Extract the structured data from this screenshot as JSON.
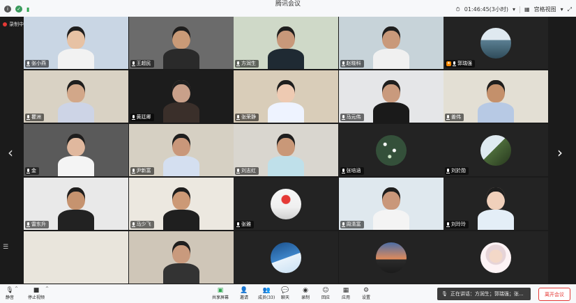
{
  "window": {
    "title": "腾讯会议"
  },
  "topbar": {
    "time": "01:46:45(3小时)",
    "view_label": "宫格视图"
  },
  "recording": {
    "label": "录制中"
  },
  "participants": [
    {
      "name": "张小燕",
      "bg": "#c9d6e4",
      "shirt": "#f2f2f2",
      "skin": "#e7c2a4",
      "avatar": ""
    },
    {
      "name": "王超民",
      "bg": "#6b6b6b",
      "shirt": "#2a2a2a",
      "skin": "#c99a77",
      "avatar": ""
    },
    {
      "name": "方润生",
      "bg": "#cfd9c8",
      "shirt": "#1f2a33",
      "skin": "#c8987a",
      "avatar": ""
    },
    {
      "name": "赵晓科",
      "bg": "#c7d3d9",
      "shirt": "#f0f0f0",
      "skin": "#c9997a",
      "avatar": ""
    },
    {
      "name": "郭瑞强",
      "bg": "#232323",
      "shirt": "",
      "skin": "",
      "avatar": "lake",
      "host": true
    },
    {
      "name": "瞿洲",
      "bg": "#d9d2c4",
      "shirt": "#cdd4e6",
      "skin": "#d2a789",
      "avatar": ""
    },
    {
      "name": "黄廷卿",
      "bg": "#1c1c1c",
      "shirt": "#3a2f2a",
      "skin": "#c9a08a",
      "avatar": ""
    },
    {
      "name": "张荣静",
      "bg": "#d9cdb9",
      "shirt": "#eef3ff",
      "skin": "#eecab2",
      "avatar": ""
    },
    {
      "name": "马元伟",
      "bg": "#e5e6e8",
      "shirt": "#1a1a1a",
      "skin": "#c99a7d",
      "avatar": ""
    },
    {
      "name": "姜伟",
      "bg": "#e3dfd4",
      "shirt": "#b7c9e4",
      "skin": "#c4906b",
      "avatar": ""
    },
    {
      "name": "金",
      "bg": "#5a5a5a",
      "shirt": "#f4f4f4",
      "skin": "#e0b89e",
      "avatar": ""
    },
    {
      "name": "尹新富",
      "bg": "#d6d0c3",
      "shirt": "#d4dff0",
      "skin": "#c9977a",
      "avatar": ""
    },
    {
      "name": "刘志红",
      "bg": "#d9d6cf",
      "shirt": "#bfe0ea",
      "skin": "#c99878",
      "avatar": ""
    },
    {
      "name": "张培涵",
      "bg": "#232323",
      "shirt": "",
      "skin": "",
      "avatar": "flowers"
    },
    {
      "name": "刘於勋",
      "bg": "#232323",
      "shirt": "",
      "skin": "",
      "avatar": "bird"
    },
    {
      "name": "雷东升",
      "bg": "#e9e9e9",
      "shirt": "#222",
      "skin": "#c6936f",
      "avatar": ""
    },
    {
      "name": "马少飞",
      "bg": "#ece8e0",
      "shirt": "#1f1f1f",
      "skin": "#cc9976",
      "avatar": ""
    },
    {
      "name": "张雅",
      "bg": "#232323",
      "shirt": "",
      "skin": "",
      "avatar": "balloon"
    },
    {
      "name": "周清富",
      "bg": "#dfe8ee",
      "shirt": "#f4f4f4",
      "skin": "#c9977a",
      "avatar": ""
    },
    {
      "name": "刘玲玲",
      "bg": "#232323",
      "shirt": "#e4eef7",
      "skin": "#f0d0bb",
      "avatar": ""
    },
    {
      "name": "",
      "bg": "#e9e5dc",
      "shirt": "",
      "skin": "",
      "avatar": ""
    },
    {
      "name": "",
      "bg": "#cfc6b8",
      "shirt": "#333",
      "skin": "#c99a7d",
      "avatar": ""
    },
    {
      "name": "",
      "bg": "#232323",
      "shirt": "",
      "skin": "",
      "avatar": "wave"
    },
    {
      "name": "",
      "bg": "#232323",
      "shirt": "",
      "skin": "",
      "avatar": "sunset"
    },
    {
      "name": "",
      "bg": "#232323",
      "shirt": "",
      "skin": "",
      "avatar": "girl"
    }
  ],
  "toolbar": {
    "mute": "静音",
    "stop_video": "停止视频",
    "share": "共享屏幕",
    "invite": "邀请",
    "members": "成员(33)",
    "chat": "聊天",
    "record": "录制",
    "apps_back": "回应",
    "apps": "应用",
    "settings": "设置",
    "speaking": "正在讲话：方润生；郭瑞强；张...",
    "leave": "离开会议"
  }
}
